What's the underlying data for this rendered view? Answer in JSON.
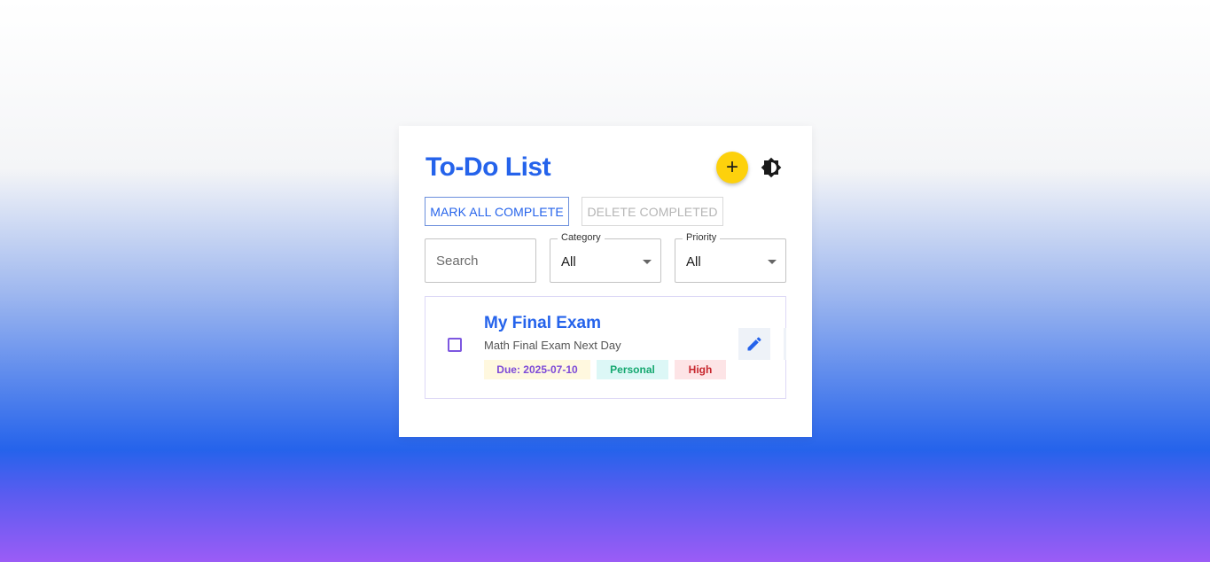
{
  "header": {
    "title": "To-Do List",
    "add_icon": "plus-icon",
    "add_symbol": "+",
    "theme_icon": "brightness-icon"
  },
  "actions": {
    "mark_all_label": "MARK ALL COMPLETE",
    "delete_completed_label": "DELETE COMPLETED"
  },
  "filters": {
    "search_placeholder": "Search",
    "category": {
      "label": "Category",
      "value": "All"
    },
    "priority": {
      "label": "Priority",
      "value": "All"
    }
  },
  "tasks": [
    {
      "title": "My Final Exam",
      "description": "Math Final Exam Next Day",
      "due": "Due: 2025-07-10",
      "category": "Personal",
      "priority": "High",
      "completed": false,
      "edit_icon": "pencil-icon"
    }
  ],
  "colors": {
    "accent": "#2563eb",
    "add_button": "#fdd10c",
    "checkbox": "#7d57e0",
    "due_text": "#7d4ad8",
    "category_text": "#15a870",
    "priority_text": "#c7272e"
  }
}
